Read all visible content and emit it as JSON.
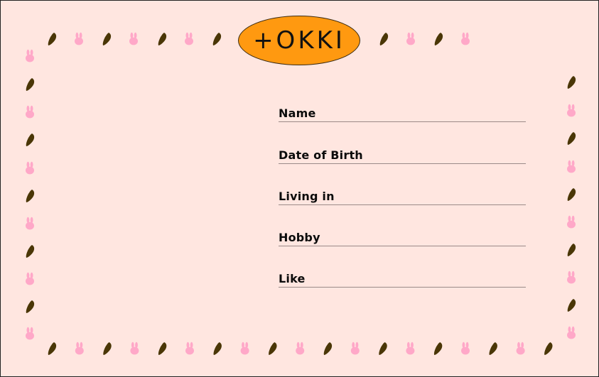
{
  "card": {
    "title": "+OKKI",
    "fields": [
      {
        "label": "Name"
      },
      {
        "label": "Date of Birth"
      },
      {
        "label": "Living in"
      },
      {
        "label": "Hobby"
      },
      {
        "label": "Like"
      }
    ]
  },
  "decorations": {
    "icons": [
      "carrot-icon",
      "bunny-icon"
    ]
  },
  "colors": {
    "background": "#ffe6e0",
    "title_badge": "#ff9910",
    "carrot": "#4a3606",
    "bunny": "#ffa8c8"
  }
}
